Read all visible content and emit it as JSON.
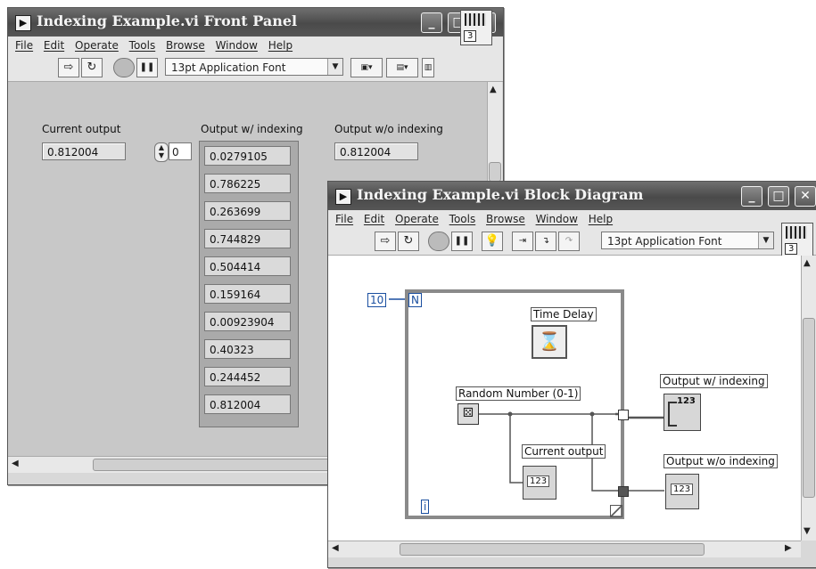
{
  "front_panel": {
    "title": "Indexing Example.vi Front Panel",
    "menu": [
      "File",
      "Edit",
      "Operate",
      "Tools",
      "Browse",
      "Window",
      "Help"
    ],
    "toolbar": {
      "run_glyph": "⇨",
      "run_cont_glyph": "↻",
      "pause_glyph": "❚❚",
      "font": "13pt Application Font",
      "dropdown_glyph": "▼"
    },
    "current_output": {
      "label": "Current output",
      "value": "0.812004"
    },
    "array_index": "0",
    "with_indexing": {
      "label": "Output w/ indexing",
      "values": [
        "0.0279105",
        "0.786225",
        "0.263699",
        "0.744829",
        "0.504414",
        "0.159164",
        "0.00923904",
        "0.40323",
        "0.244452",
        "0.812004"
      ]
    },
    "without_indexing": {
      "label": "Output w/o indexing",
      "value": "0.812004"
    },
    "connector_number": "3"
  },
  "block_diagram": {
    "title": "Indexing Example.vi Block Diagram",
    "menu": [
      "File",
      "Edit",
      "Operate",
      "Tools",
      "Browse",
      "Window",
      "Help"
    ],
    "toolbar": {
      "font": "13pt Application Font",
      "dropdown_glyph": "▼"
    },
    "loop_count_constant": "10",
    "loop_count_terminal": "N",
    "iteration_terminal": "i",
    "time_delay_label": "Time Delay",
    "time_delay_glyph": "⌛",
    "random_number_label": "Random Number (0-1)",
    "current_output_label": "Current output",
    "current_output_terminal": "123",
    "with_indexing_label": "Output w/ indexing",
    "with_indexing_terminal": "123",
    "without_indexing_label": "Output w/o indexing",
    "without_indexing_terminal": "123",
    "connector_number": "3"
  },
  "colors": {
    "title_bar": "#555555",
    "panel_background": "#c8c8c8",
    "diagram_background": "#ffffff"
  }
}
